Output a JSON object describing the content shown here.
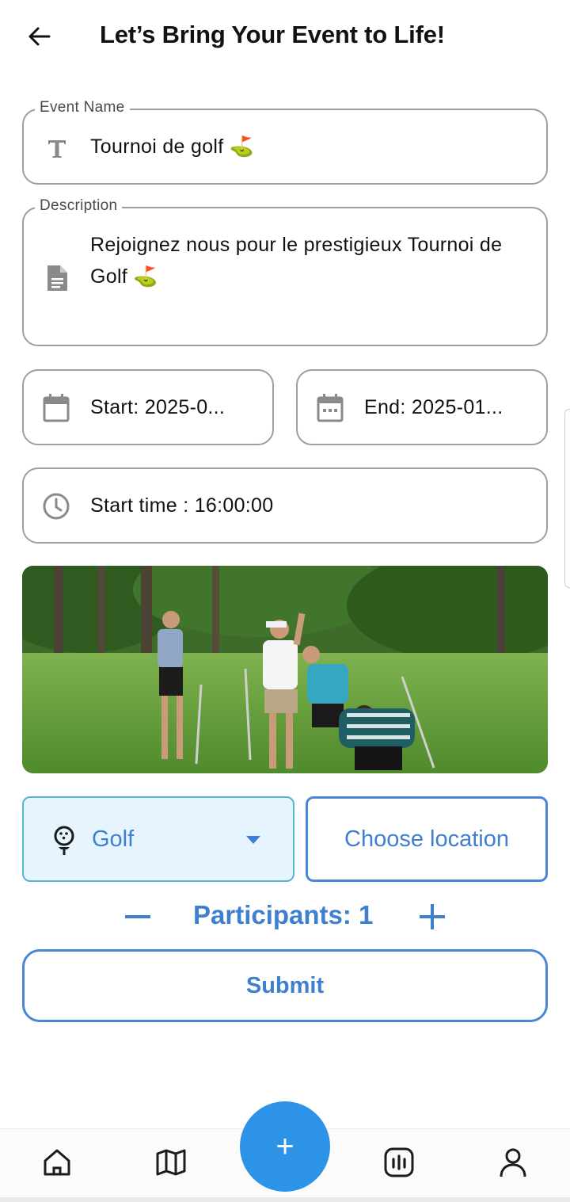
{
  "header": {
    "title": "Let’s Bring Your Event to Life!",
    "back_icon": "arrow-left-icon"
  },
  "form": {
    "event_name": {
      "label": "Event Name",
      "value": "Tournoi de golf ⛳",
      "icon": "text-icon"
    },
    "description": {
      "label": "Description",
      "value": "Rejoignez nous pour le prestigieux Tournoi de Golf ⛳",
      "icon": "document-icon"
    },
    "start_date": {
      "text": "Start: 2025-0...",
      "icon": "calendar-icon"
    },
    "end_date": {
      "text": "End: 2025-01...",
      "icon": "calendar-icon"
    },
    "start_time": {
      "text": "Start time : 16:00:00",
      "icon": "clock-icon"
    },
    "image": {
      "alt": "golf players celebrating on course"
    },
    "sport": {
      "value": "Golf",
      "icon": "golf-ball-icon",
      "dropdown_icon": "caret-down-icon"
    },
    "location": {
      "label": "Choose location"
    },
    "participants": {
      "label": "Participants: 1",
      "count": 1,
      "minus_icon": "minus-icon",
      "plus_icon": "plus-icon"
    },
    "submit_label": "Submit"
  },
  "nav": {
    "items": [
      {
        "name": "home",
        "icon": "home-icon"
      },
      {
        "name": "map",
        "icon": "map-icon"
      },
      {
        "name": "add",
        "icon": "plus-icon",
        "label": "+"
      },
      {
        "name": "stats",
        "icon": "stats-icon"
      },
      {
        "name": "profile",
        "icon": "user-icon"
      }
    ]
  },
  "colors": {
    "accent": "#3e7fcf",
    "fab": "#2d93e6",
    "select_bg": "#e6f5fd",
    "select_border": "#55b4d8",
    "field_border": "#9e9e9e"
  }
}
